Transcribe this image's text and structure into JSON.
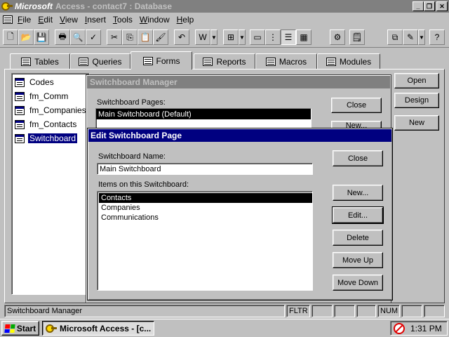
{
  "app": {
    "brand": "Microsoft",
    "title_rest": "Access - contact7 : Database"
  },
  "menu": [
    "File",
    "Edit",
    "View",
    "Insert",
    "Tools",
    "Window",
    "Help"
  ],
  "tabs": [
    "Tables",
    "Queries",
    "Forms",
    "Reports",
    "Macros",
    "Modules"
  ],
  "active_tab": "Forms",
  "forms": [
    "Codes",
    "fm_Comm",
    "fm_Companies",
    "fm_Contacts",
    "Switchboard"
  ],
  "selected_form": "Switchboard",
  "db_buttons": {
    "open": "Open",
    "design": "Design",
    "new": "New"
  },
  "switchboard_manager": {
    "title": "Switchboard Manager",
    "pages_label": "Switchboard Pages:",
    "pages": [
      "Main Switchboard (Default)"
    ],
    "close": "Close",
    "new": "New..."
  },
  "edit_page": {
    "title": "Edit Switchboard Page",
    "name_label": "Switchboard Name:",
    "name_value": "Main Switchboard",
    "items_label": "Items on this Switchboard:",
    "items": [
      "Contacts",
      "Companies",
      "Communications"
    ],
    "close": "Close",
    "new": "New...",
    "edit": "Edit...",
    "delete": "Delete",
    "move_up": "Move Up",
    "move_down": "Move Down"
  },
  "status": {
    "text": "Switchboard Manager",
    "fltr": "FLTR",
    "num": "NUM"
  },
  "taskbar": {
    "start": "Start",
    "task": "Microsoft Access - [c...",
    "clock": "1:31 PM"
  },
  "icons": {
    "title": "key-icon",
    "tray": "no-entry-icon"
  }
}
